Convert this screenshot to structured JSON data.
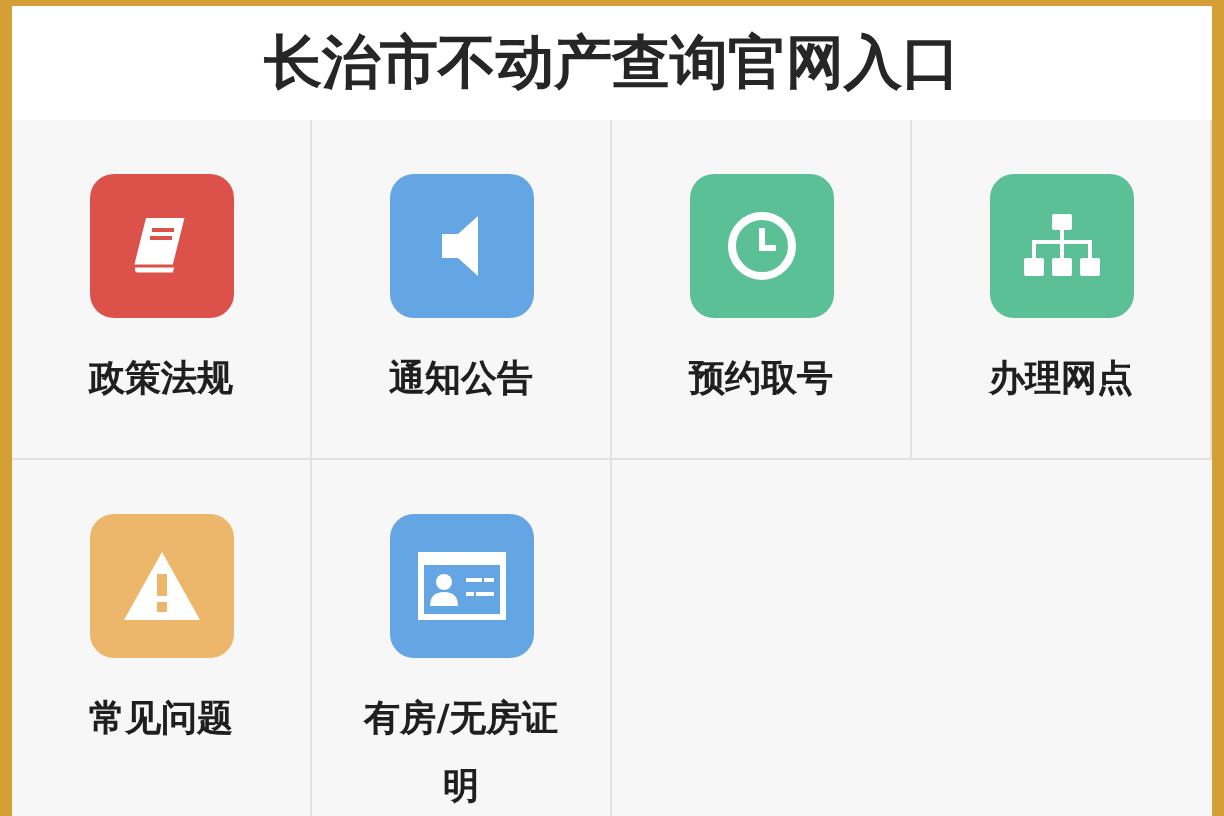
{
  "title": "长治市不动产查询官网入口",
  "items": [
    {
      "label": "政策法规",
      "color": "#dc524b"
    },
    {
      "label": "通知公告",
      "color": "#64a5e3"
    },
    {
      "label": "预约取号",
      "color": "#5bc096"
    },
    {
      "label": "办理网点",
      "color": "#5bc096"
    },
    {
      "label": "常见问题",
      "color": "#ecb76b"
    },
    {
      "label": "有房/无房证明",
      "color": "#64a5e3"
    }
  ]
}
